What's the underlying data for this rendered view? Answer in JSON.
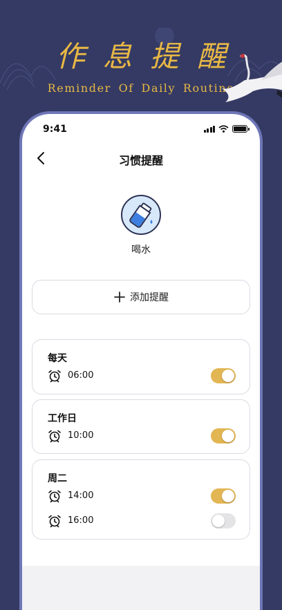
{
  "banner": {
    "title": "作息提醒",
    "subtitle": "Reminder Of Daily Routine"
  },
  "status_bar": {
    "time": "9:41"
  },
  "nav": {
    "title": "习惯提醒",
    "back_icon": "chevron-left-icon"
  },
  "habit": {
    "name": "喝水",
    "icon": "water-bottle-icon"
  },
  "add_button": {
    "label": "添加提醒",
    "icon": "plus-icon"
  },
  "colors": {
    "background": "#343a63",
    "accent": "#e3b654",
    "phone_border": "#6e76b6"
  },
  "groups": [
    {
      "title": "每天",
      "reminders": [
        {
          "time": "06:00",
          "enabled": true
        }
      ]
    },
    {
      "title": "工作日",
      "reminders": [
        {
          "time": "10:00",
          "enabled": true
        }
      ]
    },
    {
      "title": "周二",
      "reminders": [
        {
          "time": "14:00",
          "enabled": true
        },
        {
          "time": "16:00",
          "enabled": false
        }
      ]
    }
  ]
}
